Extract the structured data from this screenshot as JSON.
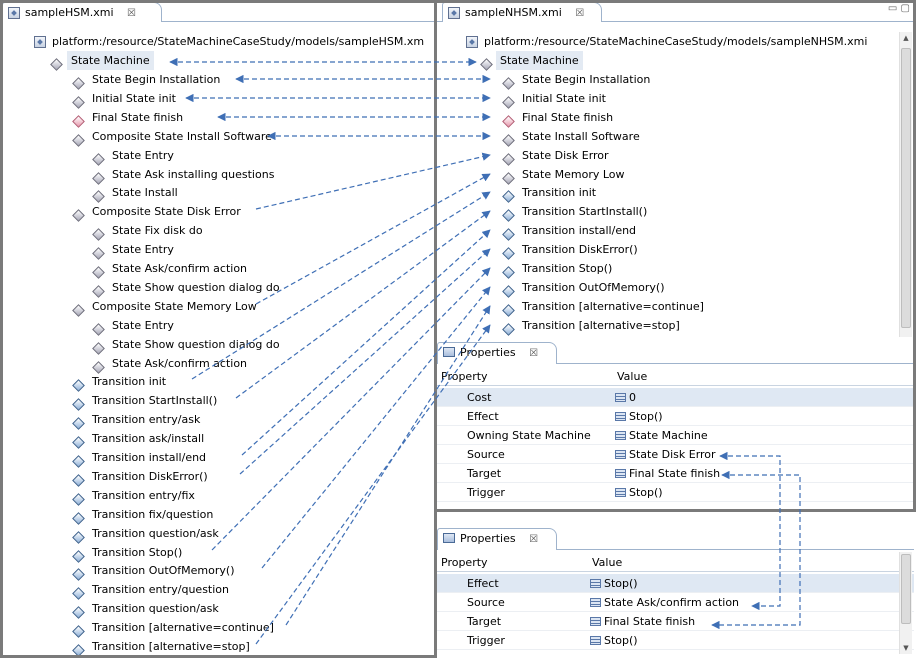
{
  "left_editor": {
    "tab_label": "sampleHSM.xmi",
    "close_glyph": "☒",
    "root": "platform:/resource/StateMachineCaseStudy/models/sampleHSM.xm",
    "state_machine": "State Machine",
    "items": [
      {
        "label": "State Begin Installation",
        "icon": "diamond-gray"
      },
      {
        "label": "Initial State init",
        "icon": "diamond-gray"
      },
      {
        "label": "Final State finish",
        "icon": "diamond-pink"
      },
      {
        "label": "Composite State Install Software",
        "icon": "diamond-gray"
      },
      {
        "label": "State Entry",
        "icon": "diamond-gray"
      },
      {
        "label": "State Ask installing questions",
        "icon": "diamond-gray"
      },
      {
        "label": "State Install",
        "icon": "diamond-gray"
      },
      {
        "label": "Composite State Disk Error",
        "icon": "diamond-gray"
      },
      {
        "label": "State Fix disk do",
        "icon": "diamond-gray"
      },
      {
        "label": "State Entry",
        "icon": "diamond-gray"
      },
      {
        "label": "State Ask/confirm action",
        "icon": "diamond-gray"
      },
      {
        "label": "State Show question dialog do",
        "icon": "diamond-gray"
      },
      {
        "label": "Composite State Memory Low",
        "icon": "diamond-gray"
      },
      {
        "label": "State Entry",
        "icon": "diamond-gray"
      },
      {
        "label": "State Show question dialog do",
        "icon": "diamond-gray"
      },
      {
        "label": "State Ask/confirm action",
        "icon": "diamond-gray"
      },
      {
        "label": "Transition init",
        "icon": "diamond-blue"
      },
      {
        "label": "Transition StartInstall()",
        "icon": "diamond-blue"
      },
      {
        "label": "Transition entry/ask",
        "icon": "diamond-blue"
      },
      {
        "label": "Transition ask/install",
        "icon": "diamond-blue"
      },
      {
        "label": "Transition install/end",
        "icon": "diamond-blue"
      },
      {
        "label": "Transition DiskError()",
        "icon": "diamond-blue"
      },
      {
        "label": "Transition entry/fix",
        "icon": "diamond-blue"
      },
      {
        "label": "Transition fix/question",
        "icon": "diamond-blue"
      },
      {
        "label": "Transition question/ask",
        "icon": "diamond-blue"
      },
      {
        "label": "Transition Stop()",
        "icon": "diamond-blue"
      },
      {
        "label": "Transition OutOfMemory()",
        "icon": "diamond-blue"
      },
      {
        "label": "Transition entry/question",
        "icon": "diamond-blue"
      },
      {
        "label": "Transition question/ask",
        "icon": "diamond-blue"
      },
      {
        "label": "Transition [alternative=continue]",
        "icon": "diamond-blue"
      },
      {
        "label": "Transition [alternative=stop]",
        "icon": "diamond-blue"
      }
    ]
  },
  "right_editor": {
    "tab_label": "sampleNHSM.xmi",
    "close_glyph": "☒",
    "window_controls": "▭ ▢",
    "root": "platform:/resource/StateMachineCaseStudy/models/sampleNHSM.xmi",
    "state_machine": "State Machine",
    "items": [
      {
        "label": "State Begin Installation",
        "icon": "diamond-gray"
      },
      {
        "label": "Initial State init",
        "icon": "diamond-gray"
      },
      {
        "label": "Final State finish",
        "icon": "diamond-pink"
      },
      {
        "label": "State Install Software",
        "icon": "diamond-gray"
      },
      {
        "label": "State Disk Error",
        "icon": "diamond-gray"
      },
      {
        "label": "State Memory Low",
        "icon": "diamond-gray"
      },
      {
        "label": "Transition init",
        "icon": "diamond-blue"
      },
      {
        "label": "Transition StartInstall()",
        "icon": "diamond-blue"
      },
      {
        "label": "Transition install/end",
        "icon": "diamond-blue"
      },
      {
        "label": "Transition DiskError()",
        "icon": "diamond-blue"
      },
      {
        "label": "Transition Stop()",
        "icon": "diamond-blue"
      },
      {
        "label": "Transition OutOfMemory()",
        "icon": "diamond-blue"
      },
      {
        "label": "Transition [alternative=continue]",
        "icon": "diamond-blue"
      },
      {
        "label": "Transition [alternative=stop]",
        "icon": "diamond-blue"
      }
    ]
  },
  "properties_top": {
    "tab_label": "Properties",
    "close_glyph": "☒",
    "col_property": "Property",
    "col_value": "Value",
    "rows": [
      {
        "name": "Cost",
        "value": "0"
      },
      {
        "name": "Effect",
        "value": "Stop()"
      },
      {
        "name": "Owning State Machine",
        "value": "State Machine"
      },
      {
        "name": "Source",
        "value": "State Disk Error"
      },
      {
        "name": "Target",
        "value": "Final State finish"
      },
      {
        "name": "Trigger",
        "value": "Stop()"
      }
    ]
  },
  "properties_bottom": {
    "tab_label": "Properties",
    "close_glyph": "☒",
    "col_property": "Property",
    "col_value": "Value",
    "rows": [
      {
        "name": "Effect",
        "value": "Stop()"
      },
      {
        "name": "Source",
        "value": "State Ask/confirm action"
      },
      {
        "name": "Target",
        "value": "Final State finish"
      },
      {
        "name": "Trigger",
        "value": "Stop()"
      }
    ]
  },
  "colors": {
    "arrow": "#3f6fb5",
    "frame": "#7a7a7a",
    "tab_border": "#9fb3cc"
  }
}
